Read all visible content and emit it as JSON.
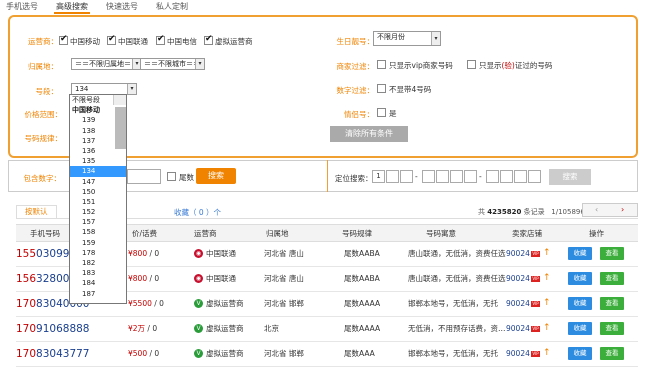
{
  "top_tabs": [
    "手机选号",
    "高级搜索",
    "快速选号",
    "私人定制"
  ],
  "filters": {
    "carrier_label": "运营商：",
    "carriers": [
      "中国移动",
      "中国联通",
      "中国电信",
      "虚拟运营商"
    ],
    "region_label": "归属地：",
    "province_select": "＝＝不限归属地＝",
    "city_select": "＝＝不限城市＝＝",
    "segment_label": "号段：",
    "segment_select": "134",
    "price_label": "价格范围：",
    "pattern_label": "号码规律：",
    "contains_label": "包含数字：",
    "tail_label": "尾数",
    "search_btn": "搜索",
    "birthday_label": "生日靓号：",
    "birthday_select": "不限月份",
    "vendor_label": "商家过滤：",
    "vendor_opt1": "只显示vip商家号码",
    "vendor_opt2_a": "只显示",
    "vendor_opt2_b": "(验)",
    "vendor_opt2_c": "证过的号码",
    "digit_label": "数字过滤：",
    "digit_opt": "不显带4号码",
    "couple_label": "情侣号：",
    "couple_opt": "是",
    "clear_btn": "清除所有条件",
    "position_label": "定位搜索：",
    "position_first": "1",
    "position_search": "搜索"
  },
  "segment_dropdown": {
    "options": [
      "不限号段",
      "中国移动",
      "139",
      "138",
      "137",
      "136",
      "135",
      "134",
      "147",
      "150",
      "151",
      "152",
      "157",
      "158",
      "159",
      "178",
      "182",
      "183",
      "184",
      "187"
    ],
    "highlighted": "134"
  },
  "results": {
    "tab_default": "按默认",
    "collect_text": "收藏（ 0 ）个",
    "total_prefix": "共",
    "total_count": "4235820",
    "total_suffix": "条记录",
    "page_info": "1/105896",
    "columns": [
      "手机号码",
      "价/话费",
      "运营商",
      "归属地",
      "号码规律",
      "号码寓意",
      "卖家店铺",
      "操作"
    ],
    "rows": [
      {
        "pre": "155",
        "suf": "0309999",
        "price": "¥800",
        "credit": " / 0",
        "carrier": "中国联通",
        "carrier_type": "cu",
        "region": "河北省 唐山",
        "pattern": "尾数AABA",
        "meaning": "唐山联通，无低消，资费任选",
        "shop": "90024"
      },
      {
        "pre": "156",
        "suf": "3280000",
        "price": "¥800",
        "credit": " / 0",
        "carrier": "中国联通",
        "carrier_type": "cu",
        "region": "河北省 唐山",
        "pattern": "尾数AABA",
        "meaning": "唐山联通，无低消，资费任选",
        "shop": "90024"
      },
      {
        "pre": "170",
        "suf": "83040000",
        "price": "¥5500",
        "credit": " / 0",
        "carrier": "虚拟运营商",
        "carrier_type": "vn",
        "region": "河北省 邯郸",
        "pattern": "尾数AAAA",
        "meaning": "邯郸本地号，无低消，无托",
        "shop": "90024"
      },
      {
        "pre": "170",
        "suf": "91068888",
        "price": "¥2万",
        "credit": " / 0",
        "carrier": "虚拟运营商",
        "carrier_type": "vn",
        "region": "北京",
        "pattern": "尾数AAAA",
        "meaning": "无低消，不用预存话费，资…",
        "shop": "90024"
      },
      {
        "pre": "170",
        "suf": "83043777",
        "price": "¥500",
        "credit": " / 0",
        "carrier": "虚拟运营商",
        "carrier_type": "vn",
        "region": "河北省 邯郸",
        "pattern": "尾数AAA",
        "meaning": "邯郸本地号，无低消，无托",
        "shop": "90024"
      }
    ],
    "collect_btn": "收藏",
    "view_btn": "查看"
  },
  "colors": {
    "accent": "#f08300",
    "number_prefix": "#c40000",
    "number_suffix": "#1a3f8f"
  }
}
